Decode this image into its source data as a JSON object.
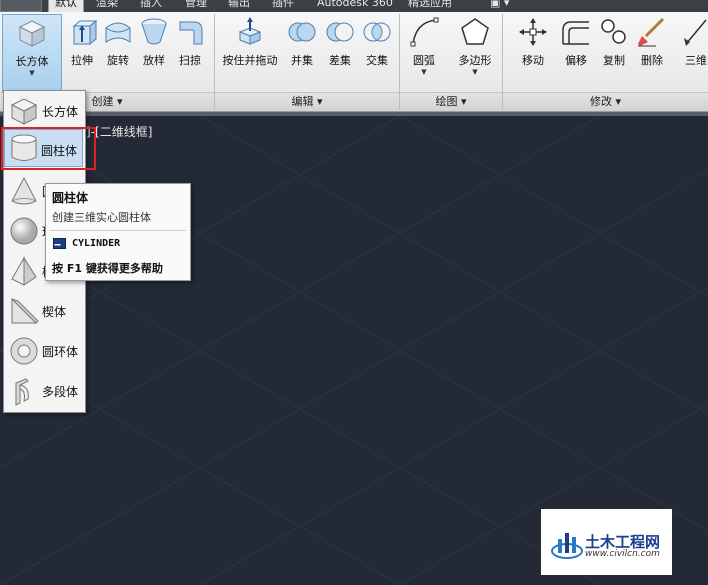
{
  "tabs": [
    {
      "label": "默认",
      "active": true
    },
    {
      "label": "渲染",
      "active": false
    },
    {
      "label": "插入",
      "active": false
    },
    {
      "label": "管理",
      "active": false
    },
    {
      "label": "输出",
      "active": false
    },
    {
      "label": "插件",
      "active": false
    },
    {
      "label": "Autodesk 360",
      "active": false
    },
    {
      "label": "精选应用",
      "active": false
    }
  ],
  "ribbon": {
    "create_tools": [
      "长方体",
      "拉伸",
      "旋转",
      "放样",
      "扫掠"
    ],
    "create_panel": "创建",
    "edit_tools": [
      "按住并拖动",
      "并集",
      "差集",
      "交集"
    ],
    "edit_panel": "编辑",
    "draw_tools": [
      "圆弧",
      "多边形"
    ],
    "draw_panel": "绘图",
    "modify_tools": [
      "移动",
      "偏移",
      "复制",
      "删除",
      "三维"
    ],
    "modify_panel": "修改"
  },
  "viewport": {
    "label": "]-[二维线框]"
  },
  "dropdown": {
    "items": [
      "长方体",
      "圆柱体",
      "圆",
      "球",
      "棱",
      "楔体",
      "圆环体",
      "多段体"
    ]
  },
  "tooltip": {
    "title": "圆柱体",
    "description": "创建三维实心圆柱体",
    "command": "CYLINDER",
    "help": "按 F1 键获得更多帮助"
  },
  "watermark": {
    "title": "土木工程网",
    "url": "www.civilcn.com"
  },
  "colors": {
    "viewport_bg": "#232a35",
    "highlight_border": "#e02020",
    "selection_bg": "#cfe3f5"
  }
}
